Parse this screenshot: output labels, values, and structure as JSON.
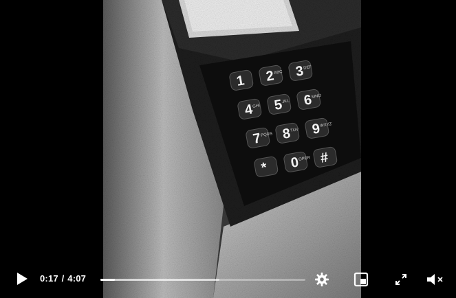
{
  "player": {
    "current_time": "0:17",
    "separator": "/",
    "duration": "4:07",
    "progress_fraction": 0.069,
    "buffered_fraction": 0.58
  },
  "controls": {
    "play_icon": "play-icon",
    "settings_icon": "gear-icon",
    "pip_icon": "picture-in-picture-icon",
    "fullscreen_icon": "expand-icon",
    "volume_icon": "speaker-muted-icon"
  },
  "keypad": {
    "keys": [
      "1",
      "2",
      "3",
      "4",
      "5",
      "6",
      "7",
      "8",
      "9",
      "*",
      "0",
      "#"
    ],
    "sublabels": [
      "",
      "ABC",
      "DEF",
      "GHI",
      "JKL",
      "MNO",
      "PQRS",
      "TUV",
      "WXYZ",
      "",
      "OPER",
      ""
    ]
  },
  "colors": {
    "background": "#000000",
    "control_fg": "#ffffff"
  }
}
